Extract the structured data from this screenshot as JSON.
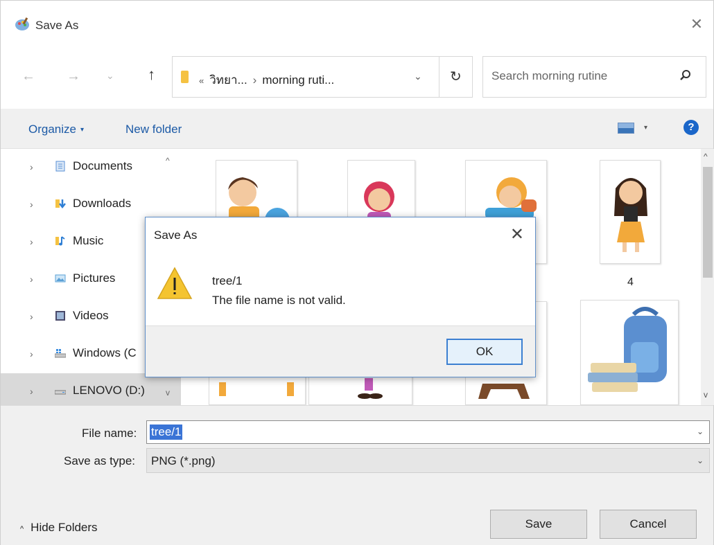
{
  "window": {
    "title": "Save As",
    "close_glyph": "✕",
    "icon": "paint-app-icon"
  },
  "nav": {
    "back_glyph": "←",
    "forward_glyph": "→",
    "recent_glyph": "⌄",
    "up_glyph": "↑"
  },
  "address": {
    "prefix": "«",
    "crumbs": [
      "วิทยา...",
      "morning ruti..."
    ],
    "separator": "›",
    "dropdown_glyph": "⌄",
    "refresh_glyph": "↻"
  },
  "search": {
    "placeholder": "Search morning rutine",
    "icon": "search-icon"
  },
  "toolbar": {
    "organize_label": "Organize",
    "caret": "▾",
    "new_folder_label": "New folder",
    "view_icon": "view-options-icon",
    "help_glyph": "?"
  },
  "sidebar": {
    "items": [
      {
        "label": "Documents",
        "icon": "documents-icon",
        "color": "#5a8fd6"
      },
      {
        "label": "Downloads",
        "icon": "downloads-icon",
        "color": "#2f7fd4"
      },
      {
        "label": "Music",
        "icon": "music-icon",
        "color": "#e8a62c"
      },
      {
        "label": "Pictures",
        "icon": "pictures-icon",
        "color": "#5aa0d6"
      },
      {
        "label": "Videos",
        "icon": "videos-icon",
        "color": "#4a4a6a"
      },
      {
        "label": "Windows (C",
        "icon": "drive-c-icon",
        "color": "#6a8fbf"
      },
      {
        "label": "LENOVO (D:)",
        "icon": "drive-d-icon",
        "color": "#888888"
      }
    ],
    "chevron_glyph": "›",
    "scroll_up_glyph": "^",
    "scroll_down_glyph": "v"
  },
  "files": {
    "captions": [
      "4"
    ],
    "scroll_up_glyph": "^",
    "scroll_down_glyph": "v"
  },
  "form": {
    "file_name_label": "File name:",
    "file_name_value": "tree/1",
    "save_type_label": "Save as type:",
    "save_type_value": "PNG (*.png)",
    "dropdown_glyph": "⌄",
    "hide_folders_label": "Hide Folders",
    "hide_folders_glyph": "^",
    "save_label": "Save",
    "cancel_label": "Cancel"
  },
  "modal": {
    "title": "Save As",
    "close_glyph": "✕",
    "file_name": "tree/1",
    "message": "The file name is not valid.",
    "ok_label": "OK",
    "icon": "warning-icon",
    "colors": {
      "warning": "#f4c430",
      "accent": "#3c7fd1"
    }
  }
}
